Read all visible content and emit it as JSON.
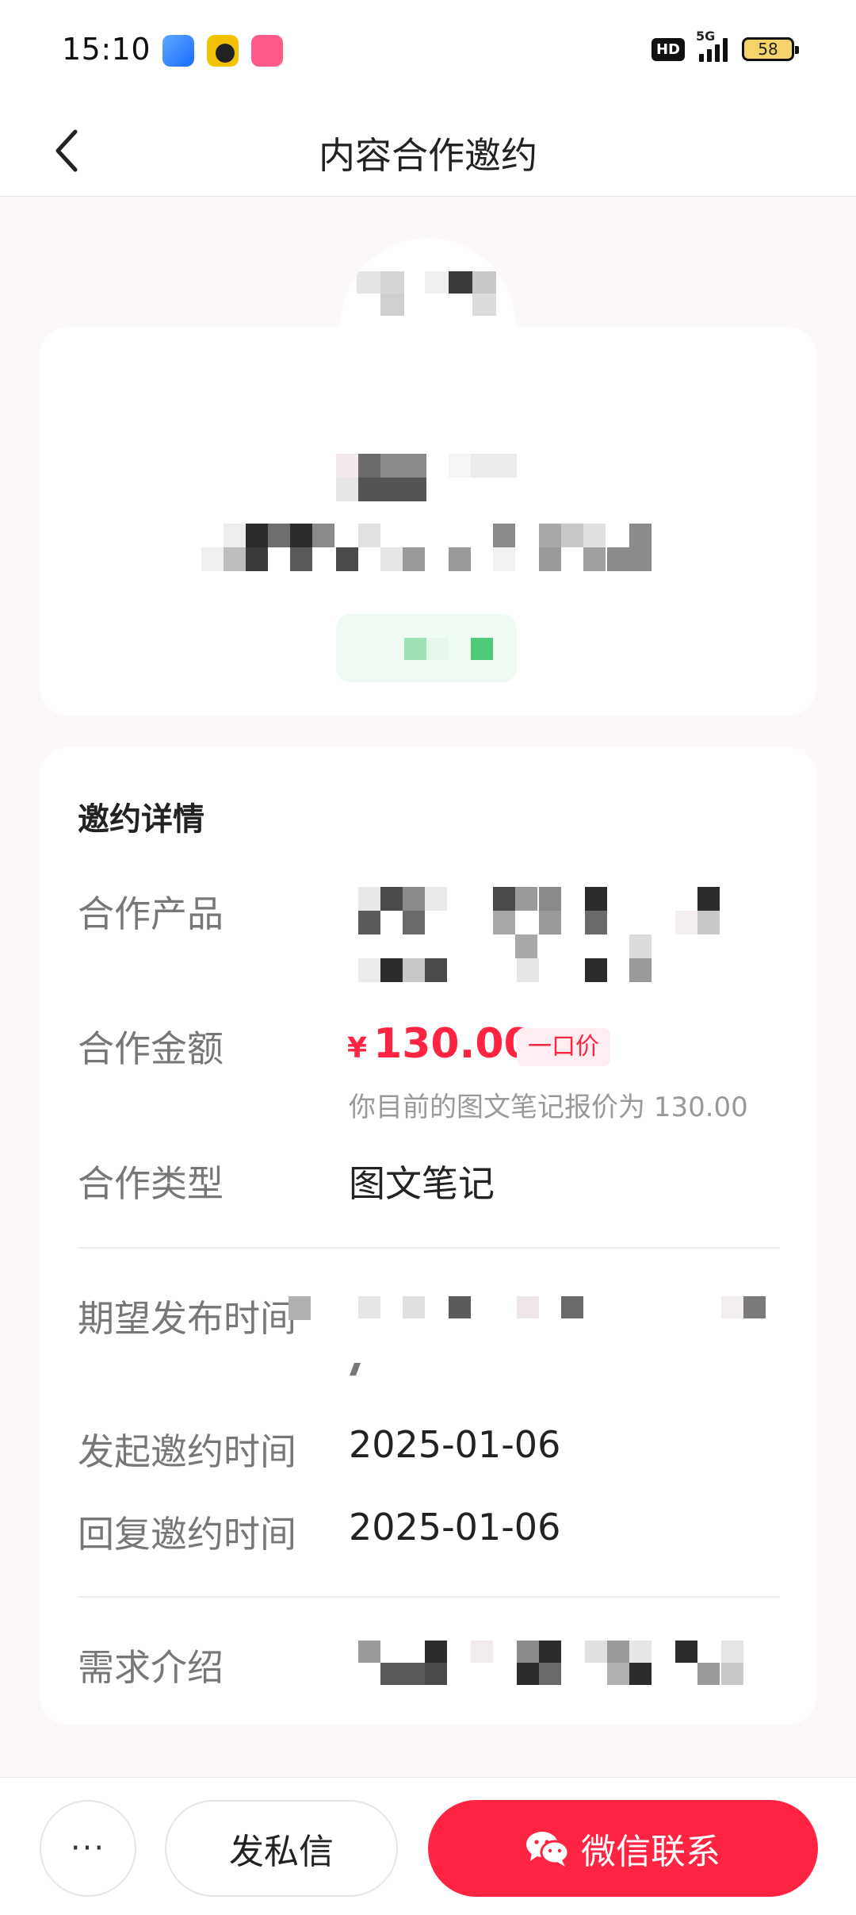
{
  "status_bar": {
    "time": "15:10",
    "hd": "HD",
    "network": "5G",
    "battery": "58"
  },
  "header": {
    "title": "内容合作邀约",
    "back_icon": "chevron-left-icon"
  },
  "details": {
    "section_title": "邀约详情",
    "product_label": "合作产品",
    "amount_label": "合作金额",
    "currency": "¥",
    "amount": "130.00",
    "price_badge": "一口价",
    "price_note": "你目前的图文笔记报价为 130.00",
    "type_label": "合作类型",
    "type_value": "图文笔记",
    "expected_time_label": "期望发布时间",
    "start_time_label": "发起邀约时间",
    "start_time_value": "2025-01-06",
    "reply_time_label": "回复邀约时间",
    "reply_time_value": "2025-01-06",
    "requirement_label": "需求介绍"
  },
  "bottom_bar": {
    "more_label": "···",
    "message_label": "发私信",
    "wechat_label": "微信联系",
    "wechat_icon": "wechat-icon"
  },
  "colors": {
    "brand": "#ff2442",
    "page_bg": "#fcf8fb"
  }
}
